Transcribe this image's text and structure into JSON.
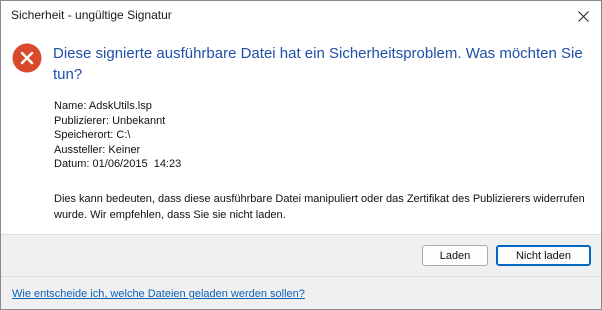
{
  "window": {
    "title": "Sicherheit - ungültige Signatur"
  },
  "icons": {
    "close": "close-icon",
    "error": "error-icon"
  },
  "colors": {
    "headline": "#1f4fa8",
    "error_icon": "#d94a2c",
    "link": "#0b61b8",
    "default_button_border": "#0067c0"
  },
  "main": {
    "headline": "Diese signierte ausführbare Datei hat ein Sicherheitsproblem.  Was möchten Sie tun?",
    "details": [
      {
        "label": "Name:",
        "value": "AdskUtils.lsp"
      },
      {
        "label": "Publizierer:",
        "value": "Unbekannt"
      },
      {
        "label": "Speicherort:",
        "value": "C:\\"
      },
      {
        "label": "Aussteller:",
        "value": "Keiner"
      },
      {
        "label": "Datum:",
        "value": "01/06/2015  14:23"
      }
    ],
    "message": "Dies kann bedeuten, dass diese ausführbare Datei manipuliert oder das Zertifikat des Publizierers widerrufen wurde. Wir empfehlen, dass Sie sie nicht laden."
  },
  "buttons": {
    "load": "Laden",
    "dont_load": "Nicht laden"
  },
  "footer": {
    "help_link": "Wie entscheide ich, welche Dateien geladen werden sollen?"
  }
}
